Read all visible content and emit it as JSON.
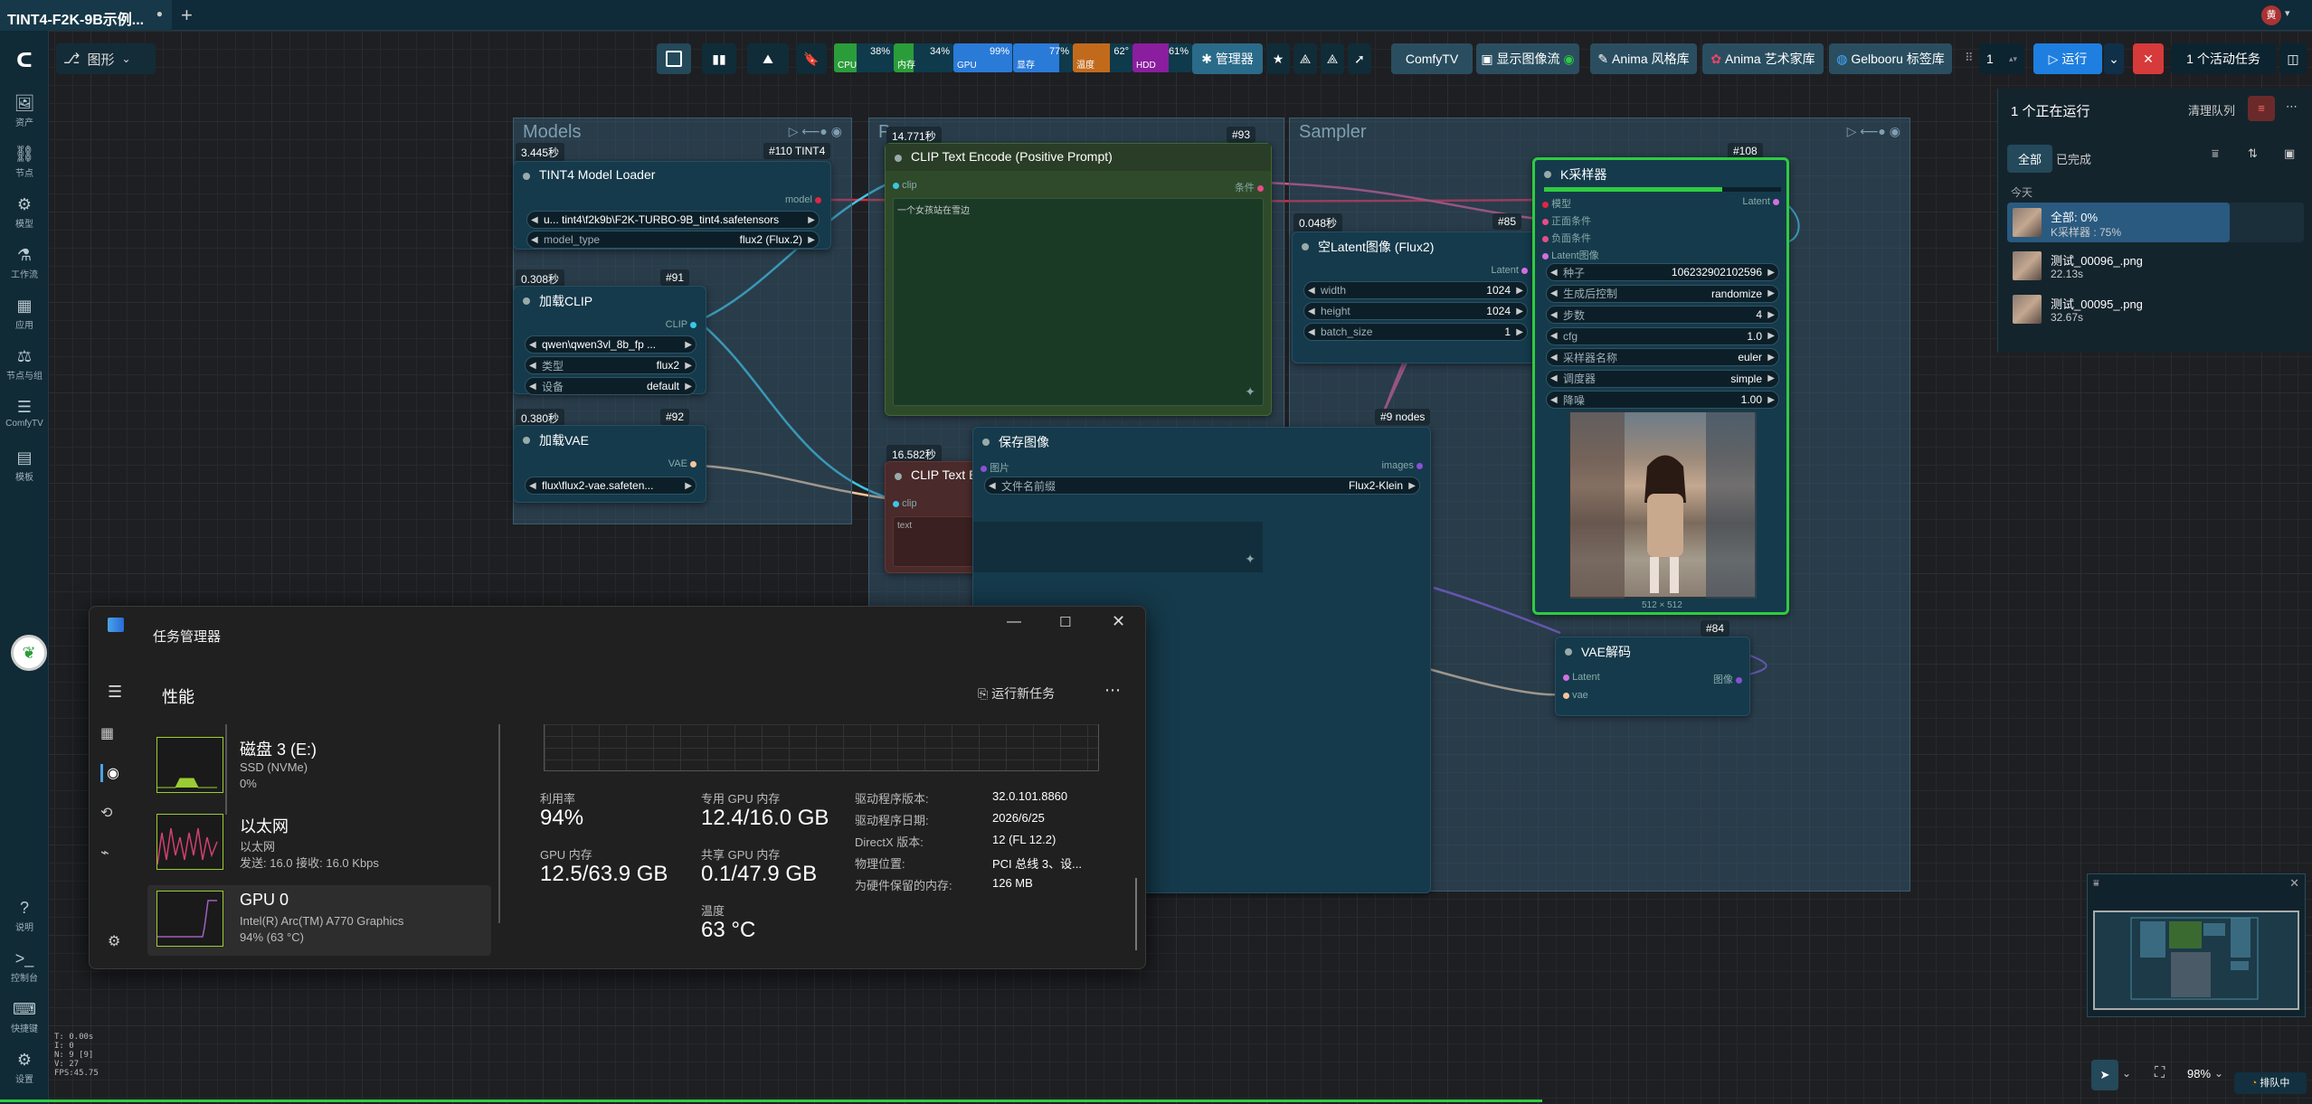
{
  "tab": {
    "title": "TINT4-F2K-9B示例...",
    "close": "●",
    "add": "+",
    "avatar": "黄"
  },
  "sidebar": {
    "items": [
      {
        "icon": "🖼",
        "label": "资产"
      },
      {
        "icon": "⛓",
        "label": "节点"
      },
      {
        "icon": "⚙",
        "label": "模型"
      },
      {
        "icon": "⚗",
        "label": "工作流"
      },
      {
        "icon": "▦",
        "label": "应用"
      },
      {
        "icon": "⚖",
        "label": "节点与组"
      },
      {
        "icon": "☰",
        "label": "ComfyTV"
      },
      {
        "icon": "▤",
        "label": "模板"
      }
    ],
    "bottom": [
      {
        "icon": "?",
        "label": "说明"
      },
      {
        "icon": ">_",
        "label": "控制台"
      },
      {
        "icon": "⌨",
        "label": "快捷键"
      },
      {
        "icon": "⚙",
        "label": "设置"
      }
    ]
  },
  "mode": {
    "label": "图形"
  },
  "meters": [
    {
      "name": "CPU",
      "pct": "38%",
      "fill": 0.38,
      "color": "#2a9d3a"
    },
    {
      "name": "内存",
      "pct": "34%",
      "fill": 0.34,
      "color": "#2a9d3a"
    },
    {
      "name": "GPU",
      "pct": "99%",
      "fill": 0.99,
      "color": "#2a7ad8"
    },
    {
      "name": "显存",
      "pct": "77%",
      "fill": 0.77,
      "color": "#2a7ad8"
    },
    {
      "name": "温度",
      "pct": "62°",
      "fill": 0.62,
      "color": "#c26a1c"
    },
    {
      "name": "HDD",
      "pct": "61%",
      "fill": 0.61,
      "color": "#8a1e9e"
    }
  ],
  "toolbar": {
    "manager": "管理器",
    "comfytv": "ComfyTV",
    "show_image_stream": "显示图像流",
    "anima_style": "Anima 风格库",
    "anima_artist": "Anima 艺术家库",
    "gelbooru": "Gelbooru 标签库",
    "batch_count": "1",
    "run": "运行",
    "active_tasks": "1 个活动任务"
  },
  "groups": {
    "models": "Models",
    "prompt": "P",
    "sampler": "Sampler"
  },
  "nodes": {
    "model_loader": {
      "title": "TINT4 Model Loader",
      "time": "3.445秒",
      "id": "#110 TINT4",
      "out": "model",
      "w1v": "u... tint4\\f2k9b\\F2K-TURBO-9B_tint4.safetensors",
      "w2k": "model_type",
      "w2v": "flux2 (Flux.2)"
    },
    "clip_loader": {
      "title": "加载CLIP",
      "time": "0.308秒",
      "id": "#91",
      "out": "CLIP",
      "w1v": "qwen\\qwen3vl_8b_fp ...",
      "w2k": "类型",
      "w2v": "flux2",
      "w3k": "设备",
      "w3v": "default"
    },
    "vae_loader": {
      "title": "加载VAE",
      "time": "0.380秒",
      "id": "#92",
      "out": "VAE",
      "w1v": "flux\\flux2-vae.safeten..."
    },
    "clip_pos": {
      "title": "CLIP Text Encode (Positive Prompt)",
      "time": "14.771秒",
      "id": "#93",
      "in": "clip",
      "out": "条件",
      "text": "一个女孩站在雪边"
    },
    "clip_neg": {
      "title": "CLIP Text E",
      "time": "16.582秒",
      "in": "clip",
      "text": "text"
    },
    "empty_latent": {
      "title": "空Latent图像 (Flux2)",
      "time": "0.048秒",
      "id": "#85",
      "out": "Latent",
      "width_k": "width",
      "width_v": "1024",
      "height_k": "height",
      "height_v": "1024",
      "batch_k": "batch_size",
      "batch_v": "1"
    },
    "save_image": {
      "title": "保存图像",
      "id": "#9 nodes",
      "in": "图片",
      "out": "images",
      "w1k": "文件名前缀",
      "w1v": "Flux2-Klein"
    },
    "ksampler": {
      "title": "K采样器",
      "id": "#108",
      "in1": "模型",
      "in2": "正面条件",
      "in3": "负面条件",
      "in4": "Latent图像",
      "out": "Latent",
      "progress": 0.75,
      "widgets": [
        {
          "k": "种子",
          "v": "106232902102596"
        },
        {
          "k": "生成后控制",
          "v": "randomize"
        },
        {
          "k": "步数",
          "v": "4"
        },
        {
          "k": "cfg",
          "v": "1.0"
        },
        {
          "k": "采样器名称",
          "v": "euler"
        },
        {
          "k": "调度器",
          "v": "simple"
        },
        {
          "k": "降噪",
          "v": "1.00"
        }
      ],
      "img_size": "512 × 512"
    },
    "vae_decode": {
      "title": "VAE解码",
      "id": "#84",
      "in1": "Latent",
      "in2": "vae",
      "out": "图像"
    }
  },
  "queue": {
    "title": "1 个正在运行",
    "clear": "清理队列",
    "tab_all": "全部",
    "tab_done": "已完成",
    "today": "今天",
    "items": [
      {
        "name": "全部: 0%",
        "sub": "K采样器 : 75%",
        "progress": 0.75
      },
      {
        "name": "测试_00096_.png",
        "sub": "22.13s"
      },
      {
        "name": "测试_00095_.png",
        "sub": "32.67s"
      }
    ]
  },
  "taskmgr": {
    "title": "任务管理器",
    "section": "性能",
    "new_task": "运行新任务",
    "devices": [
      {
        "name": "磁盘 3 (E:)",
        "sub1": "SSD (NVMe)",
        "sub2": "0%"
      },
      {
        "name": "以太网",
        "sub1": "以太网",
        "sub2": "发送: 16.0 接收: 16.0 Kbps"
      },
      {
        "name": "GPU 0",
        "sub1": "Intel(R) Arc(TM) A770 Graphics",
        "sub2": "94% (63 °C)"
      }
    ],
    "stats": {
      "util_k": "利用率",
      "util_v": "94%",
      "dgpu_k": "专用 GPU 内存",
      "dgpu_v": "12.4/16.0 GB",
      "gmem_k": "GPU 内存",
      "gmem_v": "12.5/63.9 GB",
      "sgpu_k": "共享 GPU 内存",
      "sgpu_v": "0.1/47.9 GB",
      "temp_k": "温度",
      "temp_v": "63 °C"
    },
    "info": [
      {
        "k": "驱动程序版本:",
        "v": "32.0.101.8860"
      },
      {
        "k": "驱动程序日期:",
        "v": "2026/6/25"
      },
      {
        "k": "DirectX 版本:",
        "v": "12 (FL 12.2)"
      },
      {
        "k": "物理位置:",
        "v": "PCI 总线 3、设..."
      },
      {
        "k": "为硬件保留的内存:",
        "v": "126 MB"
      }
    ]
  },
  "bottom": {
    "zoom": "98%",
    "queue_btn": "排队中",
    "stats": "T: 0.00s\nI: 0\nN: 9 [9]\nV: 27\nFPS:45.75"
  }
}
